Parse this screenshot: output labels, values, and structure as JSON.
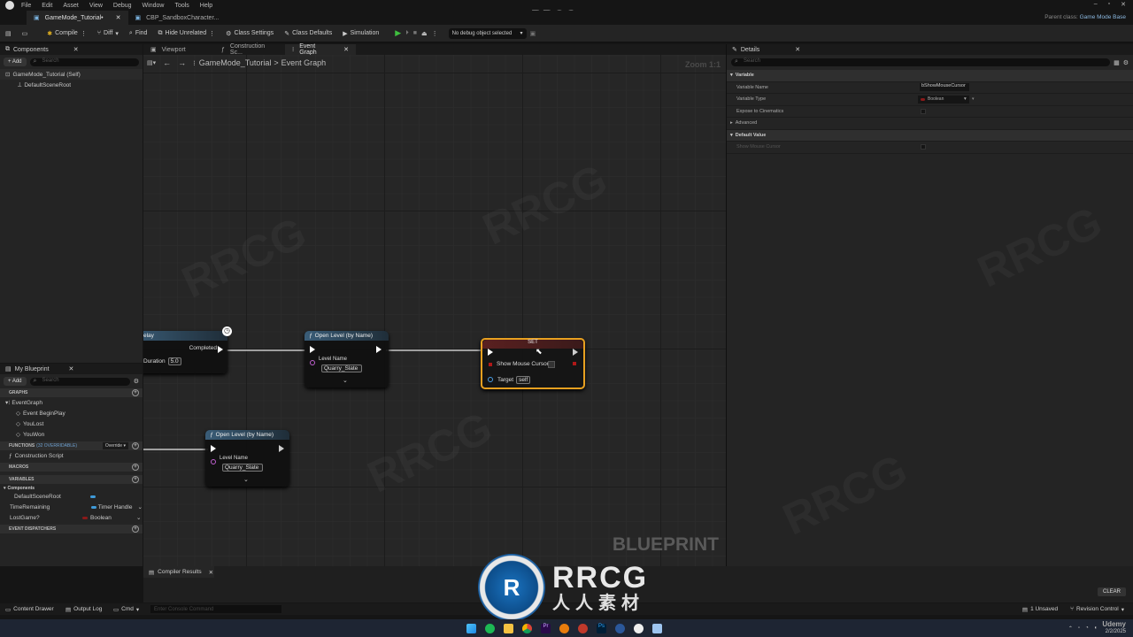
{
  "menu": [
    "File",
    "Edit",
    "Asset",
    "View",
    "Debug",
    "Window",
    "Tools",
    "Help"
  ],
  "tabs": [
    {
      "label": "GameMode_Tutorial•"
    },
    {
      "label": "CBP_SandboxCharacter..."
    }
  ],
  "watermark_top": "RRCG.cn",
  "parent_class_label": "Parent class:",
  "parent_class_value": "Game Mode Base",
  "toolbar": {
    "compile": "Compile",
    "diff": "Diff",
    "find": "Find",
    "hide_unrelated": "Hide Unrelated",
    "class_settings": "Class Settings",
    "class_defaults": "Class Defaults",
    "simulation": "Simulation",
    "debug_select": "No debug object selected"
  },
  "components": {
    "title": "Components",
    "add": "+ Add",
    "search_placeholder": "Search",
    "root": "GameMode_Tutorial (Self)",
    "child": "DefaultSceneRoot"
  },
  "editor_tabs": {
    "viewport": "Viewport",
    "construction": "Construction Sc...",
    "event_graph": "Event Graph"
  },
  "breadcrumb": {
    "root": "GameMode_Tutorial",
    "sep": ">",
    "current": "Event Graph"
  },
  "zoom": "Zoom 1:1",
  "nodes": {
    "delay": {
      "title": "elay",
      "completed": "Completed",
      "duration_label": "Duration",
      "duration_value": "5.0"
    },
    "open1": {
      "title": "Open Level (by Name)",
      "level_label": "Level Name",
      "level_value": "Quarry_Slate"
    },
    "set": {
      "title": "SET",
      "field": "Show Mouse Cursor",
      "target_label": "Target",
      "target_value": "self"
    },
    "open2": {
      "title": "Open Level (by Name)",
      "level_label": "Level Name",
      "level_value": "Quarry_Slate"
    }
  },
  "blueprint_label": "BLUEPRINT",
  "my_blueprint": {
    "title": "My Blueprint",
    "add": "+ Add",
    "search_placeholder": "Search",
    "graphs_header": "GRAPHS",
    "event_graph": "EventGraph",
    "events": [
      "Event BeginPlay",
      "YouLost",
      "YouWon"
    ],
    "functions_header": "FUNCTIONS",
    "functions_count": "(32 OVERRIDABLE)",
    "override": "Override",
    "construction_script": "Construction Script",
    "macros_header": "MACROS",
    "variables_header": "VARIABLES",
    "components_label": "Components",
    "default_scene_root": "DefaultSceneRoot",
    "variables": [
      {
        "name": "TimeRemaining",
        "type": "Timer Handle",
        "color": "#3f9ad8"
      },
      {
        "name": "LostGame?",
        "type": "Boolean",
        "color": "#8b1a1a"
      }
    ],
    "dispatchers_header": "EVENT DISPATCHERS"
  },
  "details": {
    "title": "Details",
    "search_placeholder": "Search",
    "variable_header": "Variable",
    "variable_name_label": "Variable Name",
    "variable_name_value": "bShowMouseCursor",
    "variable_type_label": "Variable Type",
    "variable_type_value": "Boolean",
    "expose_label": "Expose to Cinematics",
    "advanced": "Advanced",
    "default_value_header": "Default Value",
    "show_mouse_label": "Show Mouse Cursor"
  },
  "compiler_results": "Compiler Results",
  "clear": "CLEAR",
  "bottom": {
    "content_drawer": "Content Drawer",
    "output_log": "Output Log",
    "cmd": "Cmd",
    "console_placeholder": "Enter Console Command",
    "unsaved": "1 Unsaved",
    "revision": "Revision Control"
  },
  "rrcg_logo": {
    "main": "RRCG",
    "sub": "人人素材"
  },
  "taskbar": {
    "date": "2/2/2025",
    "udemy": "Udemy"
  }
}
